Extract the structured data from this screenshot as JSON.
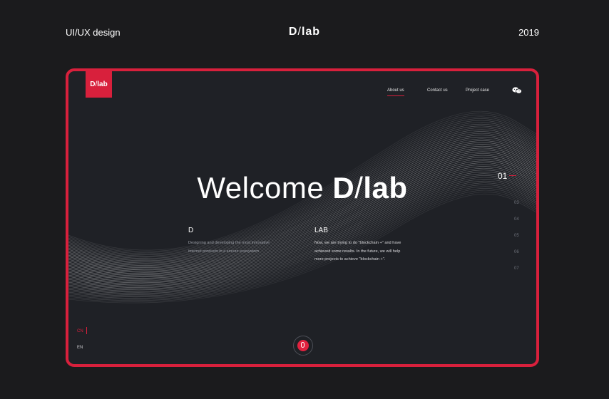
{
  "header": {
    "left_label": "UI/UX design",
    "brand_d": "D",
    "brand_slash": "/",
    "brand_lab": "lab",
    "year": "2019"
  },
  "site": {
    "logo_d": "D",
    "logo_slash": "/",
    "logo_lab": "lab",
    "nav": [
      "About us",
      "Contact us",
      "Project case"
    ],
    "active_nav": "About us",
    "hero": {
      "prefix": "Welcome",
      "brand_d": "D",
      "brand_slash": "/",
      "brand_lab": "lab"
    },
    "columns": [
      {
        "heading": "D",
        "lines": [
          "Designing and developing the most innovative",
          "internet products in a secure ecosystem"
        ]
      },
      {
        "heading": "LAB",
        "lines": [
          "Now, we are trying to do \"blockchain +\" and have",
          "achieved some results. In the future, we will help",
          "more projects to achieve \"blockchain +\"."
        ]
      }
    ],
    "pager": {
      "current": "01",
      "others": [
        "03",
        "04",
        "05",
        "06",
        "07"
      ]
    },
    "languages": [
      "CN",
      "EN"
    ],
    "active_language": "CN",
    "icons": {
      "chat": "wechat-icon",
      "scroll": "mouse-icon"
    },
    "colors": {
      "accent": "#d8203c",
      "background": "#1b1b1d",
      "panel": "#1f2126"
    }
  }
}
